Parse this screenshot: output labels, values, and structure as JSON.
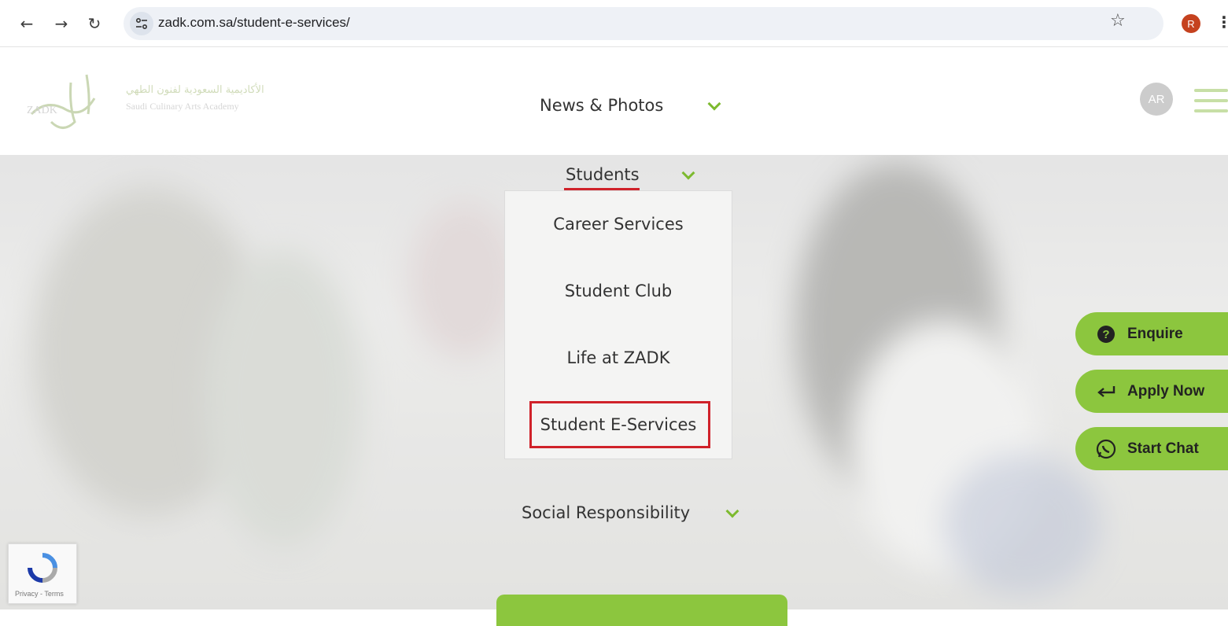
{
  "browser": {
    "url": "zadk.com.sa/student-e-services/",
    "profile_initial": "R"
  },
  "header": {
    "logo_ar": "الأكاديمية السعودية لفنون الطهي",
    "logo_en": "Saudi Culinary Arts Academy",
    "logo_short": "ZADK",
    "lang_button": "AR"
  },
  "menu": {
    "news": "News & Photos",
    "students": "Students",
    "social": "Social Responsibility"
  },
  "students_dropdown": {
    "items": [
      "Career Services",
      "Student Club",
      "Life at ZADK",
      "Student E-Services"
    ]
  },
  "floating": {
    "enquire": "Enquire",
    "apply": "Apply Now",
    "chat": "Start Chat"
  },
  "recaptcha": {
    "footer": "Privacy - Terms"
  },
  "colors": {
    "accent_green": "#8cc63e",
    "highlight_red": "#d0222a"
  }
}
